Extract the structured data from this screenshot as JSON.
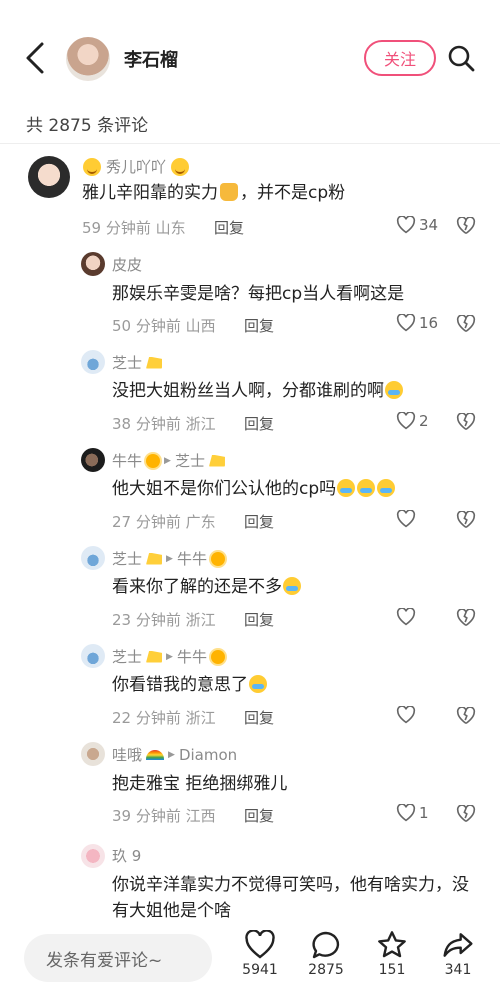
{
  "header": {
    "name": "李石榴",
    "follow_label": "关注"
  },
  "comment_count": "共 2875 条评论",
  "comments": [
    {
      "user": "秀儿吖吖",
      "text": "雅儿辛阳靠的实力",
      "text2": "，并不是cp粉",
      "time": "59 分钟前",
      "region": "山东",
      "reply": "回复",
      "likes": "34"
    },
    {
      "user": "皮皮",
      "text": "那娱乐辛雯是啥？每把cp当人看啊这是",
      "time": "50 分钟前",
      "region": "山西",
      "reply": "回复",
      "likes": "16"
    },
    {
      "user": "芝士",
      "text": "没把大姐粉丝当人啊，分都谁刷的啊",
      "time": "38 分钟前",
      "region": "浙江",
      "reply": "回复",
      "likes": "2"
    },
    {
      "user": "牛牛",
      "reply_to": "芝士",
      "text": "他大姐不是你们公认他的cp吗",
      "time": "27 分钟前",
      "region": "广东",
      "reply": "回复",
      "likes": ""
    },
    {
      "user": "芝士",
      "reply_to": "牛牛",
      "text": "看来你了解的还是不多",
      "time": "23 分钟前",
      "region": "浙江",
      "reply": "回复",
      "likes": ""
    },
    {
      "user": "芝士",
      "reply_to": "牛牛",
      "text": "你看错我的意思了",
      "time": "22 分钟前",
      "region": "浙江",
      "reply": "回复",
      "likes": ""
    },
    {
      "user": "哇哦",
      "reply_to": "Diamon",
      "text": "抱走雅宝 拒绝捆绑雅儿",
      "time": "39 分钟前",
      "region": "江西",
      "reply": "回复",
      "likes": "1"
    },
    {
      "user": "玖 9",
      "text": "你说辛洋靠实力不觉得可笑吗，他有啥实力，没有大姐他是个啥",
      "time": "",
      "region": "",
      "reply": "",
      "likes": ""
    }
  ],
  "bottom": {
    "placeholder": "发条有爱评论~",
    "likes": "5941",
    "comments": "2875",
    "favorites": "151",
    "shares": "341"
  }
}
